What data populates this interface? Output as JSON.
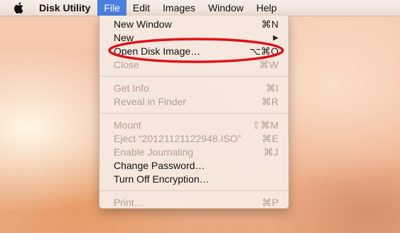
{
  "menubar": {
    "apple_icon": "apple-logo-icon",
    "app_name": "Disk Utility",
    "menus": [
      "File",
      "Edit",
      "Images",
      "Window",
      "Help"
    ],
    "active_menu": "File"
  },
  "file_menu": {
    "items": [
      {
        "label": "New Window",
        "shortcut": "⌘N",
        "enabled": true
      },
      {
        "label": "New",
        "shortcut": "▶",
        "enabled": true
      },
      {
        "label": "Open Disk Image…",
        "shortcut": "⌥⌘O",
        "enabled": true
      },
      {
        "label": "Close",
        "shortcut": "⌘W",
        "enabled": false
      },
      {
        "label": "Get Info",
        "shortcut": "⌘I",
        "enabled": false
      },
      {
        "label": "Reveal in Finder",
        "shortcut": "⌘R",
        "enabled": false
      },
      {
        "label": "Mount",
        "shortcut": "⇧⌘M",
        "enabled": false
      },
      {
        "label": "Eject “20121121122948.ISO”",
        "shortcut": "⌘E",
        "enabled": false
      },
      {
        "label": "Enable Journaling",
        "shortcut": "⌘J",
        "enabled": false
      },
      {
        "label": "Change Password…",
        "shortcut": "",
        "enabled": true
      },
      {
        "label": "Turn Off Encryption…",
        "shortcut": "",
        "enabled": true
      },
      {
        "label": "Print…",
        "shortcut": "⌘P",
        "enabled": false
      }
    ]
  },
  "annotation": {
    "color": "#e0101a",
    "highlighted_item": "Open Disk Image…"
  }
}
